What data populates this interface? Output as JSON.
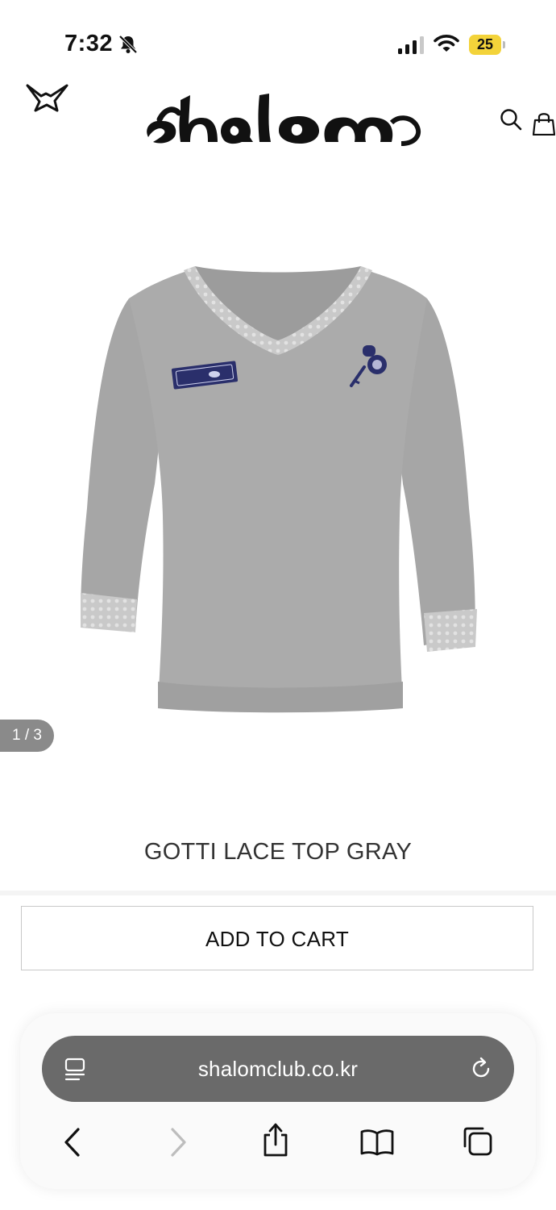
{
  "status_bar": {
    "time": "7:32",
    "battery_level": "25",
    "icons": [
      "bell-slash-icon",
      "cellular-signal-icon",
      "wifi-icon",
      "battery-icon"
    ]
  },
  "header": {
    "logo_text": "shalom",
    "icons": [
      "star-icon",
      "search-icon",
      "shopping-bag-icon"
    ]
  },
  "gallery": {
    "page_counter": "1 / 3",
    "image_subject": "gray long-sleeve v-neck top with lace trim and navy patches"
  },
  "product": {
    "name": "GOTTI LACE TOP GRAY"
  },
  "actions": {
    "add_to_cart_label": "ADD TO CART"
  },
  "browser": {
    "url": "shalomclub.co.kr",
    "toolbar_icons": [
      "back-icon",
      "forward-icon",
      "share-icon",
      "bookmarks-icon",
      "tabs-icon"
    ]
  },
  "colors": {
    "battery": "#f3d33a",
    "address_bar": "#6a6a6a",
    "counter_badge": "#8a8a8a",
    "shirt_gray": "#a8a8a8",
    "patch_navy": "#2a2f6b"
  }
}
